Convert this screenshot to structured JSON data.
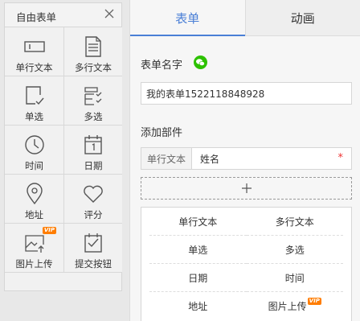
{
  "palette": {
    "title": "自由表单",
    "tools": [
      {
        "label": "单行文本",
        "icon": "single-line-text-icon"
      },
      {
        "label": "多行文本",
        "icon": "multi-line-text-icon"
      },
      {
        "label": "单选",
        "icon": "radio-select-icon"
      },
      {
        "label": "多选",
        "icon": "multi-select-icon"
      },
      {
        "label": "时间",
        "icon": "clock-icon"
      },
      {
        "label": "日期",
        "icon": "calendar-icon"
      },
      {
        "label": "地址",
        "icon": "location-pin-icon"
      },
      {
        "label": "评分",
        "icon": "heart-icon"
      },
      {
        "label": "图片上传",
        "icon": "image-upload-icon",
        "badge": "VIP"
      },
      {
        "label": "提交按钮",
        "icon": "submit-button-icon"
      }
    ]
  },
  "tabs": [
    {
      "label": "表单",
      "active": true
    },
    {
      "label": "动画",
      "active": false
    }
  ],
  "form": {
    "name_label": "表单名字",
    "name_value": "我的表单1522118848928",
    "components_label": "添加部件",
    "field": {
      "type": "单行文本",
      "name": "姓名",
      "required_mark": "*"
    },
    "add_symbol": "+"
  },
  "type_options": [
    {
      "label": "单行文本"
    },
    {
      "label": "多行文本"
    },
    {
      "label": "单选"
    },
    {
      "label": "多选"
    },
    {
      "label": "日期"
    },
    {
      "label": "时间"
    },
    {
      "label": "地址"
    },
    {
      "label": "图片上传",
      "badge": "VIP"
    }
  ],
  "colors": {
    "accent": "#4a7fd6",
    "vip": "#ff7d00",
    "wechat": "#2dc100",
    "required": "#e33333"
  }
}
